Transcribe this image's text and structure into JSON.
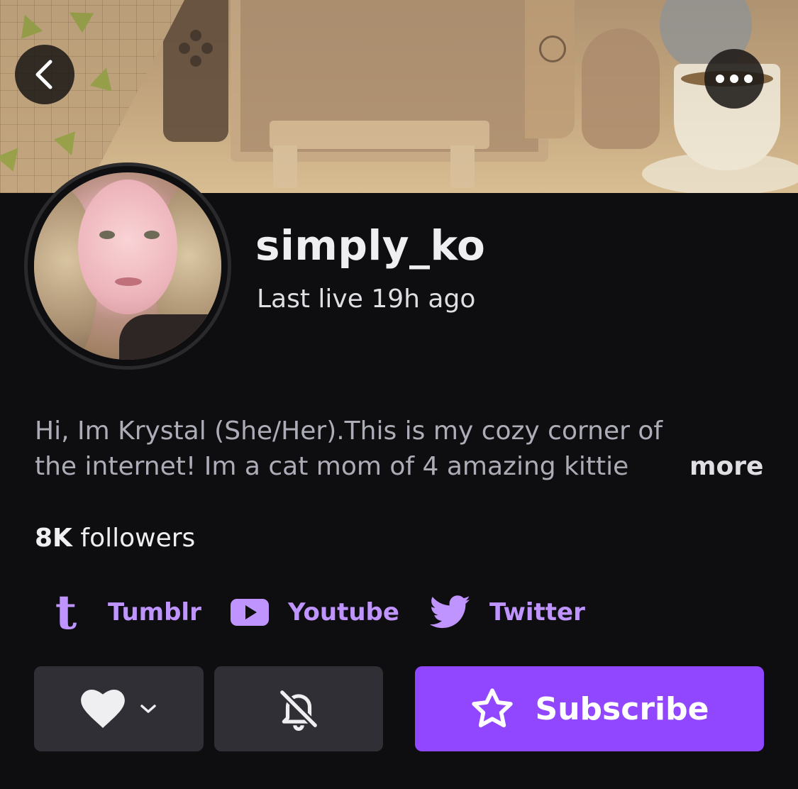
{
  "header": {
    "back_icon": "chevron-left-icon",
    "more_icon": "more-horizontal-icon"
  },
  "profile": {
    "username": "simply_ko",
    "last_live": "Last live 19h ago",
    "bio_line1": "Hi, Im Krystal (She/Her).This is my cozy corner of",
    "bio_line2": "the internet! Im a cat mom of 4 amazing kittie",
    "more_label": "more",
    "followers_count": "8K",
    "followers_label": "followers"
  },
  "socials": [
    {
      "name": "Tumblr",
      "icon": "tumblr-icon"
    },
    {
      "name": "Youtube",
      "icon": "youtube-icon"
    },
    {
      "name": "Twitter",
      "icon": "twitter-icon"
    }
  ],
  "actions": {
    "follow_icon": "heart-icon",
    "notify_icon": "bell-off-icon",
    "subscribe_label": "Subscribe",
    "subscribe_icon": "star-icon"
  },
  "colors": {
    "background": "#0e0e10",
    "accent": "#9147ff",
    "link": "#bf94ff",
    "button_dark": "#2f2f35"
  }
}
